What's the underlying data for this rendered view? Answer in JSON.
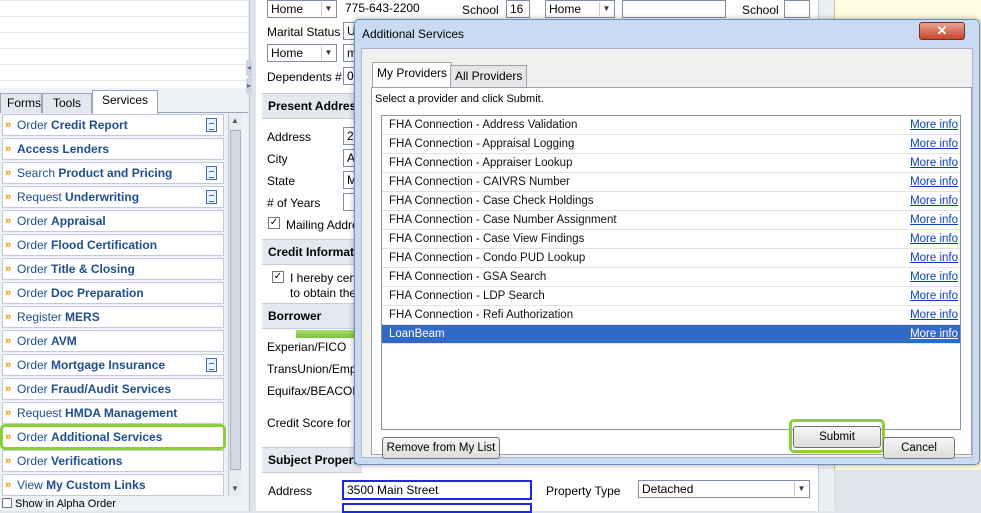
{
  "left_panel": {
    "tabs": [
      "Forms",
      "Tools",
      "Services"
    ],
    "services": [
      {
        "pre": "Order",
        "main": "Credit Report",
        "doc": true
      },
      {
        "pre": "",
        "main": "Access Lenders",
        "doc": false
      },
      {
        "pre": "Search",
        "main": "Product and Pricing",
        "doc": true
      },
      {
        "pre": "Request",
        "main": "Underwriting",
        "doc": true
      },
      {
        "pre": "Order",
        "main": "Appraisal",
        "doc": false
      },
      {
        "pre": "Order",
        "main": "Flood Certification",
        "doc": false
      },
      {
        "pre": "Order",
        "main": "Title & Closing",
        "doc": false
      },
      {
        "pre": "Order",
        "main": "Doc Preparation",
        "doc": false
      },
      {
        "pre": "Register",
        "main": "MERS",
        "doc": false
      },
      {
        "pre": "Order",
        "main": "AVM",
        "doc": false
      },
      {
        "pre": "Order",
        "main": "Mortgage Insurance",
        "doc": true
      },
      {
        "pre": "Order",
        "main": "Fraud/Audit Services",
        "doc": false
      },
      {
        "pre": "Request",
        "main": "HMDA Management",
        "doc": false
      },
      {
        "pre": "Order",
        "main": "Additional Services",
        "doc": false
      },
      {
        "pre": "Order",
        "main": "Verifications",
        "doc": false
      },
      {
        "pre": "View",
        "main": "My Custom Links",
        "doc": false
      }
    ],
    "alpha_label": "Show in Alpha Order"
  },
  "form": {
    "home1": "Home",
    "phone": "775-643-2200",
    "school_label": "School",
    "school_val": "16",
    "home2": "Home",
    "school2_label": "School",
    "marital_label": "Marital Status",
    "marital_val": "U",
    "home3": "Home",
    "home3_val": "m",
    "dependents_label": "Dependents #",
    "dependents_val": "0",
    "present_address": "Present Addres",
    "address_label": "Address",
    "address_val": "2",
    "city_label": "City",
    "city_val": "A",
    "state_label": "State",
    "state_val": "M",
    "years_label": "# of Years",
    "mailing_label": "Mailing Addres",
    "credit_info": "Credit Informat",
    "certify_text1": "I hereby cert",
    "certify_text2": "to obtain the",
    "borrower": "Borrower",
    "experian": "Experian/FICO",
    "transunion": "TransUnion/Empiri",
    "equifax": "Equifax/BEACON",
    "credit_score": "Credit Score for D",
    "subject_property": "Subject Propert",
    "sp_address_label": "Address",
    "sp_address_val": "3500 Main Street",
    "property_type_label": "Property Type",
    "property_type_val": "Detached"
  },
  "dialog": {
    "title": "Additional Services",
    "close_glyph": "✕",
    "tabs": [
      "My Providers",
      "All Providers"
    ],
    "instruction": "Select a provider and click Submit.",
    "more_info": "More info",
    "selected_index": 11,
    "providers": [
      "FHA Connection - Address Validation",
      "FHA Connection - Appraisal Logging",
      "FHA Connection - Appraiser Lookup",
      "FHA Connection - CAIVRS Number",
      "FHA Connection - Case Check Holdings",
      "FHA Connection - Case Number Assignment",
      "FHA Connection - Case View Findings",
      "FHA Connection - Condo PUD Lookup",
      "FHA Connection - GSA Search",
      "FHA Connection - LDP Search",
      "FHA Connection - Refi Authorization",
      "LoanBeam"
    ],
    "remove_label": "Remove from My List",
    "submit_label": "Submit",
    "cancel_label": "Cancel"
  },
  "highlight_color": "#8ccf3b",
  "selection_color": "#3169c6"
}
